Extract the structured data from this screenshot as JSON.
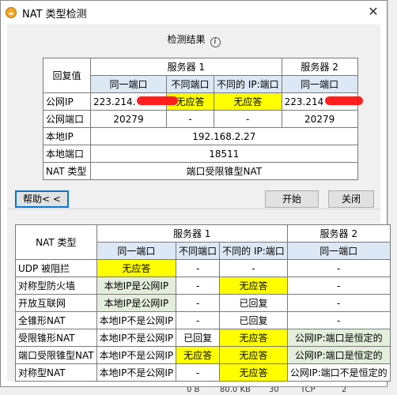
{
  "window": {
    "title": "NAT 类型检测",
    "close_glyph": "✕"
  },
  "result": {
    "label": "检测结果"
  },
  "t1": {
    "reply_value": "回复值",
    "server1": "服务器 1",
    "server2": "服务器 2",
    "same_port": "同一端口",
    "diff_port": "不同端口",
    "diff_ipport": "不同的 IP:端口",
    "same_port2": "同一端口",
    "public_ip": "公网IP",
    "public_ip_s1": "223.214.",
    "no_reply1": "无应答",
    "no_reply2": "无应答",
    "public_ip_s2": "223.214",
    "public_port": "公网端口",
    "port_s1": "20279",
    "dash1": "-",
    "dash2": "-",
    "port_s2": "20279",
    "local_ip": "本地IP",
    "local_ip_val": "192.168.2.27",
    "local_port": "本地端口",
    "local_port_val": "18511",
    "nat_type": "NAT 类型",
    "nat_type_val": "端口受限锥型NAT"
  },
  "buttons": {
    "help": "帮助< <",
    "start": "开始",
    "close": "关闭"
  },
  "t2": {
    "nat_type": "NAT 类型",
    "server1": "服务器 1",
    "server2": "服务器 2",
    "same_port": "同一端口",
    "diff_port": "不同端口",
    "diff_ipport": "不同的 IP:端口",
    "same_port2": "同一端口",
    "rows": [
      {
        "name": "UDP 被阻拦",
        "c1": "无应答",
        "c2": "-",
        "c3": "-",
        "c4": "-"
      },
      {
        "name": "对称型防火墙",
        "c1": "本地IP是公网IP",
        "c2": "-",
        "c3": "无应答",
        "c4": "-"
      },
      {
        "name": "开放互联网",
        "c1": "本地IP是公网IP",
        "c2": "-",
        "c3": "已回复",
        "c4": "-"
      },
      {
        "name": "全锥形NAT",
        "c1": "本地IP不是公网IP",
        "c2": "-",
        "c3": "已回复",
        "c4": "-"
      },
      {
        "name": "受限锥形NAT",
        "c1": "本地IP不是公网IP",
        "c2": "已回复",
        "c3": "无应答",
        "c4": "公网IP:端口是恒定的"
      },
      {
        "name": "端口受限锥型NAT",
        "c1": "本地IP不是公网IP",
        "c2": "无应答",
        "c3": "无应答",
        "c4": "公网IP:端口是恒定的"
      },
      {
        "name": "对称型NAT",
        "c1": "本地IP不是公网IP",
        "c2": "-",
        "c3": "无应答",
        "c4": "公网IP:端口不是恒定的"
      }
    ]
  },
  "background": {
    "b1": "0 B",
    "b2": "80.0 KB",
    "b3": "30",
    "b4": "TCP",
    "b5": "2"
  },
  "colors": {
    "highlight": "#ffff00",
    "accent": "#0078d7",
    "ok_cell": "#e3efdc"
  }
}
